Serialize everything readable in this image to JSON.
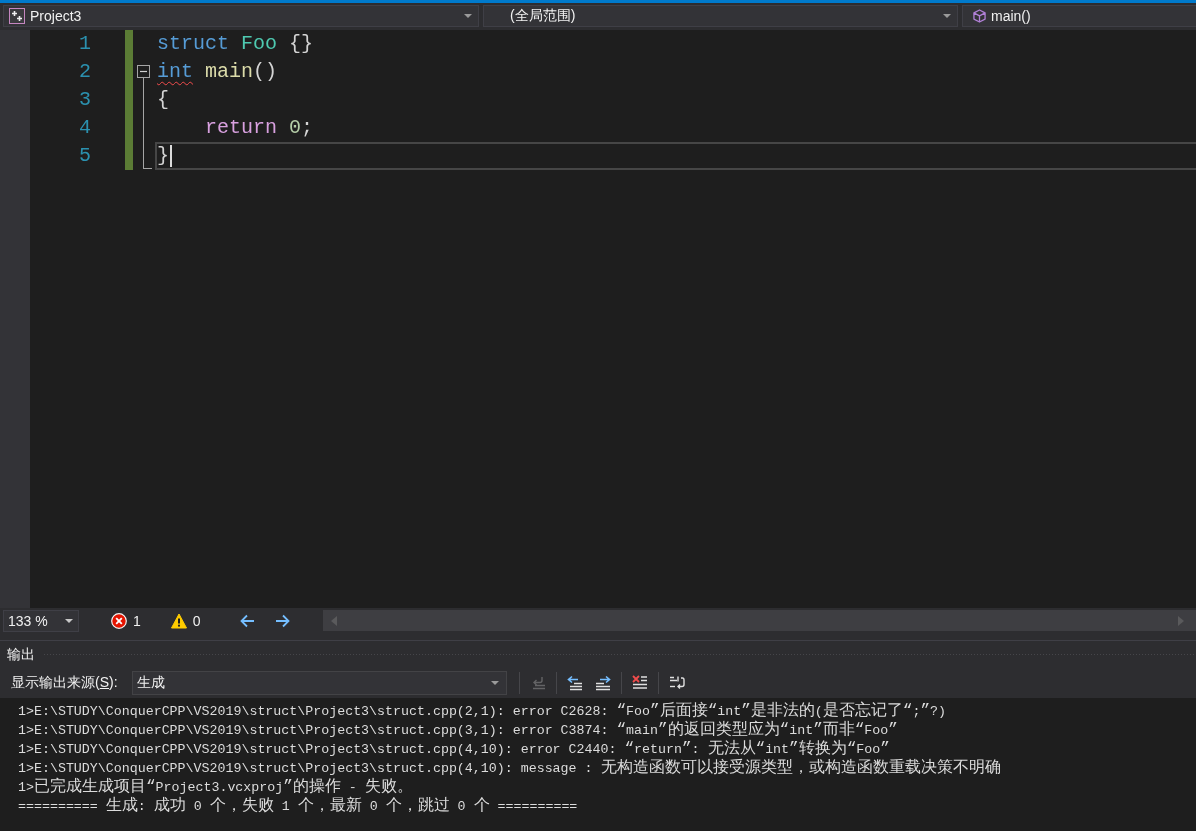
{
  "navigation_bar": {
    "project": "Project3",
    "scope": "(全局范围)",
    "member": "main()"
  },
  "editor": {
    "lines": [
      {
        "number": "1",
        "changed": true,
        "current": false,
        "tokens": [
          {
            "text": "struct",
            "kind": "keyword",
            "error": false
          },
          {
            "text": " Foo",
            "kind": "type",
            "error": false
          },
          {
            "text": " {}",
            "kind": "punctuation",
            "error": false
          }
        ]
      },
      {
        "number": "2",
        "changed": true,
        "current": false,
        "expanded": true,
        "tokens": [
          {
            "text": "int",
            "kind": "keyword",
            "error": true
          },
          {
            "text": " main",
            "kind": "function",
            "error": false
          },
          {
            "text": "()",
            "kind": "punctuation",
            "error": false
          }
        ],
        "children": [
          {
            "number": "3",
            "changed": true,
            "current": false,
            "tokens": [
              {
                "text": "{",
                "kind": "punctuation",
                "error": false
              }
            ]
          },
          {
            "number": "4",
            "changed": true,
            "current": false,
            "tokens": [
              {
                "text": "    return",
                "kind": "control",
                "error": false
              },
              {
                "text": " 0",
                "kind": "number",
                "error": false
              },
              {
                "text": ";",
                "kind": "punctuation",
                "error": false
              }
            ]
          },
          {
            "number": "5",
            "changed": true,
            "current": true,
            "tokens": [
              {
                "text": "}",
                "kind": "punctuation",
                "error": false
              }
            ]
          }
        ]
      }
    ]
  },
  "status": {
    "zoom": "133 %",
    "errors": "1",
    "warnings": "0"
  },
  "output": {
    "title": "输出",
    "source_label": {
      "before": "显示输出来源(",
      "access_key": "S",
      "after": "):"
    },
    "source": "生成",
    "toolbar": [
      [
        {
          "kind": "go-to-source",
          "disabled": true
        }
      ],
      [
        {
          "kind": "previous",
          "disabled": false
        },
        {
          "kind": "next",
          "disabled": false
        }
      ],
      [
        {
          "kind": "clear",
          "disabled": false
        }
      ],
      [
        {
          "kind": "wrap",
          "disabled": false
        }
      ]
    ],
    "lines": [
      "1>E:\\STUDY\\ConquerCPP\\VS2019\\struct\\Project3\\struct.cpp(2,1): error C2628: “Foo”后面接“int”是非法的(是否忘记了“;”?)",
      "1>E:\\STUDY\\ConquerCPP\\VS2019\\struct\\Project3\\struct.cpp(3,1): error C3874: “main”的返回类型应为“int”而非“Foo”",
      "1>E:\\STUDY\\ConquerCPP\\VS2019\\struct\\Project3\\struct.cpp(4,10): error C2440: “return”: 无法从“int”转换为“Foo”",
      "1>E:\\STUDY\\ConquerCPP\\VS2019\\struct\\Project3\\struct.cpp(4,10): message : 无构造函数可以接受源类型，或构造函数重载决策不明确",
      "1>已完成生成项目“Project3.vcxproj”的操作 - 失败。",
      "========== 生成: 成功 0 个，失败 1 个，最新 0 个，跳过 0 个 =========="
    ]
  }
}
